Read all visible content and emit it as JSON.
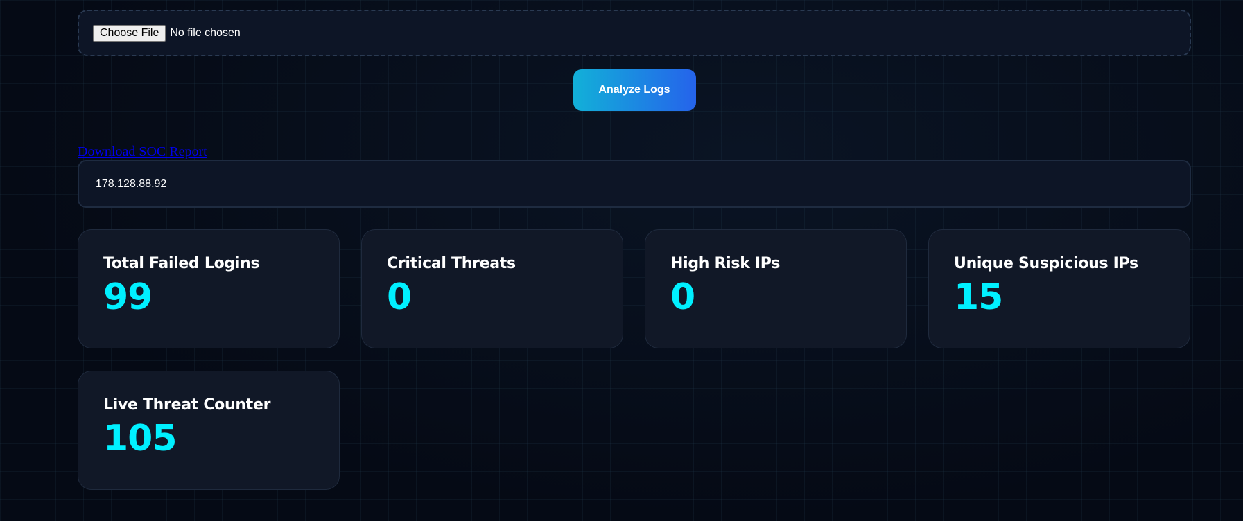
{
  "upload": {
    "button_label": "Choose File",
    "status": "No file chosen"
  },
  "analyze": {
    "label": "Analyze Logs"
  },
  "report": {
    "link_text": "Download SOC Report"
  },
  "ip_display": {
    "value": "178.128.88.92"
  },
  "stats": [
    {
      "title": "Total Failed Logins",
      "value": "99"
    },
    {
      "title": "Critical Threats",
      "value": "0"
    },
    {
      "title": "High Risk IPs",
      "value": "0"
    },
    {
      "title": "Unique Suspicious IPs",
      "value": "15"
    },
    {
      "title": "Live Threat Counter",
      "value": "105"
    }
  ],
  "colors": {
    "accent": "#00f0ff",
    "button_gradient_start": "#12b0d8",
    "button_gradient_end": "#2563eb",
    "card_bg": "#111827",
    "page_bg": "#050a15"
  }
}
